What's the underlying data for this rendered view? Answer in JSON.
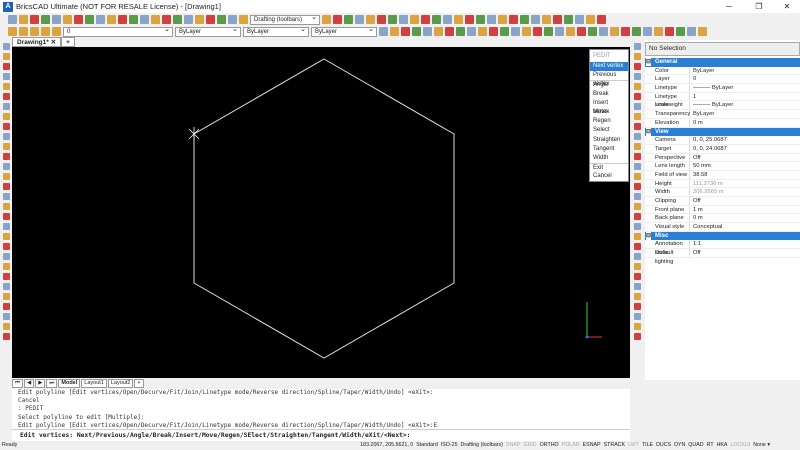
{
  "window": {
    "title": "BricsCAD Ultimate (NOT FOR RESALE License) - [Drawing1]",
    "logo": "A",
    "min": "─",
    "max": "❐",
    "close": "✕"
  },
  "toolbar": {
    "workspace": "Drafting (toolbars)",
    "layer": "0",
    "color": "ByLayer",
    "linetype": "ByLayer",
    "lineweight": "ByLayer"
  },
  "tabs": {
    "drawing": "Drawing1*",
    "close": "✕",
    "add": "+"
  },
  "menu": {
    "title": "PEDIT",
    "items": [
      "Next vertex",
      "Previous vertex",
      "Angle",
      "Break",
      "Insert vertex",
      "Move",
      "Regen",
      "Select",
      "Straighten",
      "Tangent",
      "Width",
      "Exit",
      "Cancel"
    ]
  },
  "properties": {
    "selection": "No Selection",
    "groups": [
      {
        "name": "General",
        "rows": [
          [
            "Color",
            "ByLayer"
          ],
          [
            "Layer",
            "0"
          ],
          [
            "Linetype",
            "——— ByLayer"
          ],
          [
            "Linetype scale",
            "1"
          ],
          [
            "Lineweight",
            "——— ByLayer"
          ],
          [
            "Transparency",
            "ByLayer"
          ],
          [
            "Elevation",
            "0 m"
          ]
        ]
      },
      {
        "name": "View",
        "rows": [
          [
            "Camera",
            "0, 0, 25.0687"
          ],
          [
            "Target",
            "0, 0, 24.0687"
          ],
          [
            "Perspective",
            "Off"
          ],
          [
            "Lens length",
            "50 mm"
          ],
          [
            "Field of view",
            "38.58"
          ],
          [
            "Height",
            "111.3736 m"
          ],
          [
            "Width",
            "206.9565 m"
          ],
          [
            "Clipping",
            "Off"
          ],
          [
            "Front plane",
            "1 m"
          ],
          [
            "Back plane",
            "0 m"
          ],
          [
            "Visual style",
            "Conceptual"
          ]
        ]
      },
      {
        "name": "Misc",
        "rows": [
          [
            "Annotation scale",
            "1:1"
          ],
          [
            "Default lighting",
            "Off"
          ]
        ]
      }
    ]
  },
  "layout_tabs": [
    "Model",
    "Layout1",
    "Layout2",
    "+"
  ],
  "command_history": [
    "Edit polyline [Edit vertices/Open/Decurve/Fit/Join/Linetype mode/Reverse direction/Spline/Taper/Width/Undo] <eXit>:",
    "Cancel",
    ": PEDIT",
    "Select polyline to edit [Multiple]:",
    "Edit polyline [Edit vertices/Open/Decurve/Fit/Join/Linetype mode/Reverse direction/Spline/Taper/Width/Undo] <eXit>:E"
  ],
  "prompt": "Edit vertices:  Next/Previous/Angle/Break/Insert/Move/Regen/SElect/Straighten/Tangent/Width/eXit/<Next>:",
  "status": {
    "ready": "Ready",
    "coords": "183.2067, 205.5621, 0",
    "style": "Standard",
    "dimstyle": "ISO-25",
    "workspace": "Drafting (toolbars)",
    "toggles": [
      [
        "SNAP",
        false
      ],
      [
        "GRID",
        false
      ],
      [
        "ORTHO",
        true
      ],
      [
        "POLAR",
        false
      ],
      [
        "ESNAP",
        true
      ],
      [
        "STRACK",
        true
      ],
      [
        "LWT",
        false
      ],
      [
        "TILE",
        true
      ],
      [
        "DUCS",
        true
      ],
      [
        "DYN",
        true
      ],
      [
        "QUAD",
        true
      ],
      [
        "RT",
        true
      ],
      [
        "HKA",
        true
      ],
      [
        "LOCKUI",
        false
      ],
      [
        "None ▾",
        true
      ]
    ]
  }
}
